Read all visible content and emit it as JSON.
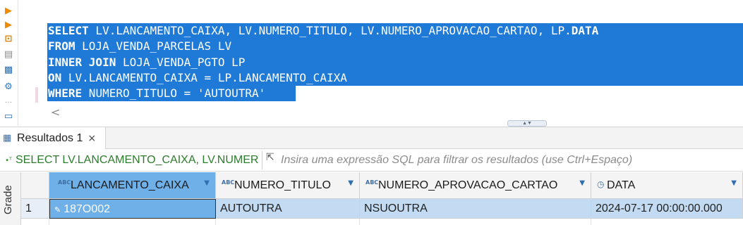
{
  "gutter_icons": [
    "run-statement-icon",
    "run-script-icon",
    "explain-icon",
    "script-file-icon",
    "console-icon",
    "settings-icon",
    "more-icon",
    "new-script-icon"
  ],
  "editor": {
    "sql_lines": [
      {
        "keyword": "SELECT",
        "rest": " LV.LANCAMENTO_CAIXA, LV.NUMERO_TITULO, LV.NUMERO_APROVACAO_CARTAO, LP.",
        "keyword2": "DATA"
      },
      {
        "keyword": "FROM",
        "rest": " LOJA_VENDA_PARCELAS LV",
        "keyword2": ""
      },
      {
        "keyword": "INNER JOIN",
        "rest": " LOJA_VENDA_PGTO LP",
        "keyword2": ""
      },
      {
        "keyword": "ON",
        "rest": " LV.LANCAMENTO_CAIXA = LP.LANCAMENTO_CAIXA",
        "keyword2": ""
      },
      {
        "keyword": "WHERE",
        "rest": " NUMERO_TITULO = 'AUTOUTRA'",
        "keyword2": ""
      }
    ],
    "hscroll_arrow": "<",
    "selection_color": "#1e7ad6"
  },
  "results": {
    "tab_label": "Resultados 1",
    "tab_close": "×",
    "filter": {
      "query_text": "SELECT LV.LANCAMENTO_CAIXA, LV.NUMER",
      "placeholder": "Insira uma expressão SQL para filtrar os resultados (use Ctrl+Espaço)"
    },
    "side_label": "Grade",
    "columns": [
      {
        "name": "LANCAMENTO_CAIXA",
        "type": "ABC"
      },
      {
        "name": "NUMERO_TITULO",
        "type": "ABC"
      },
      {
        "name": "NUMERO_APROVACAO_CARTAO",
        "type": "ABC"
      },
      {
        "name": "DATA",
        "type": "clock"
      }
    ],
    "rows": [
      {
        "num": "1",
        "cells": [
          "187O002",
          "AUTOUTRA",
          "NSUOUTRA",
          "2024-07-17 00:00:00.000"
        ]
      }
    ],
    "accent_color": "#6fb0e8",
    "row_highlight_color": "#c3dbf2"
  }
}
